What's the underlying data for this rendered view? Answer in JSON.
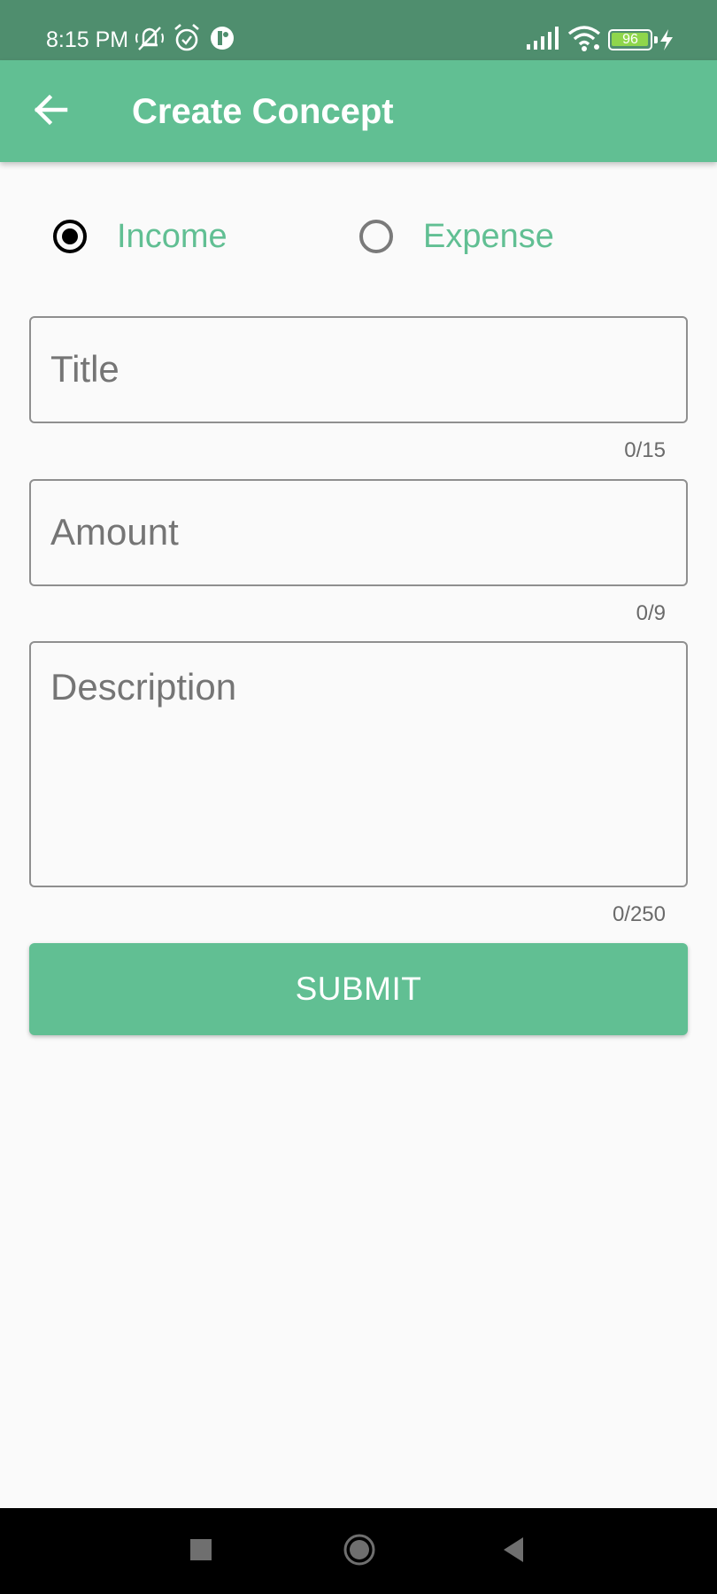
{
  "status_bar": {
    "time": "8:15 PM",
    "battery_level": "96",
    "icons": [
      "silent-icon",
      "alarm-icon",
      "app-notification-icon",
      "signal-icon",
      "wifi-icon",
      "battery-icon",
      "charging-icon"
    ]
  },
  "app_bar": {
    "title": "Create Concept",
    "back_icon": "arrow-back-icon"
  },
  "type_selector": {
    "options": [
      {
        "label": "Income",
        "checked": true
      },
      {
        "label": "Expense",
        "checked": false
      }
    ]
  },
  "form": {
    "title": {
      "placeholder": "Title",
      "value": "",
      "counter": "0/15"
    },
    "amount": {
      "placeholder": "Amount",
      "value": "",
      "counter": "0/9"
    },
    "description": {
      "placeholder": "Description",
      "value": "",
      "counter": "0/250"
    }
  },
  "submit_label": "SUBMIT",
  "nav_bar": {
    "buttons": [
      "recents-icon",
      "home-icon",
      "back-icon"
    ]
  },
  "colors": {
    "status_bar": "#4f8e6e",
    "primary": "#61bf93",
    "background": "#fafafa",
    "radio_checked": "#000000"
  }
}
